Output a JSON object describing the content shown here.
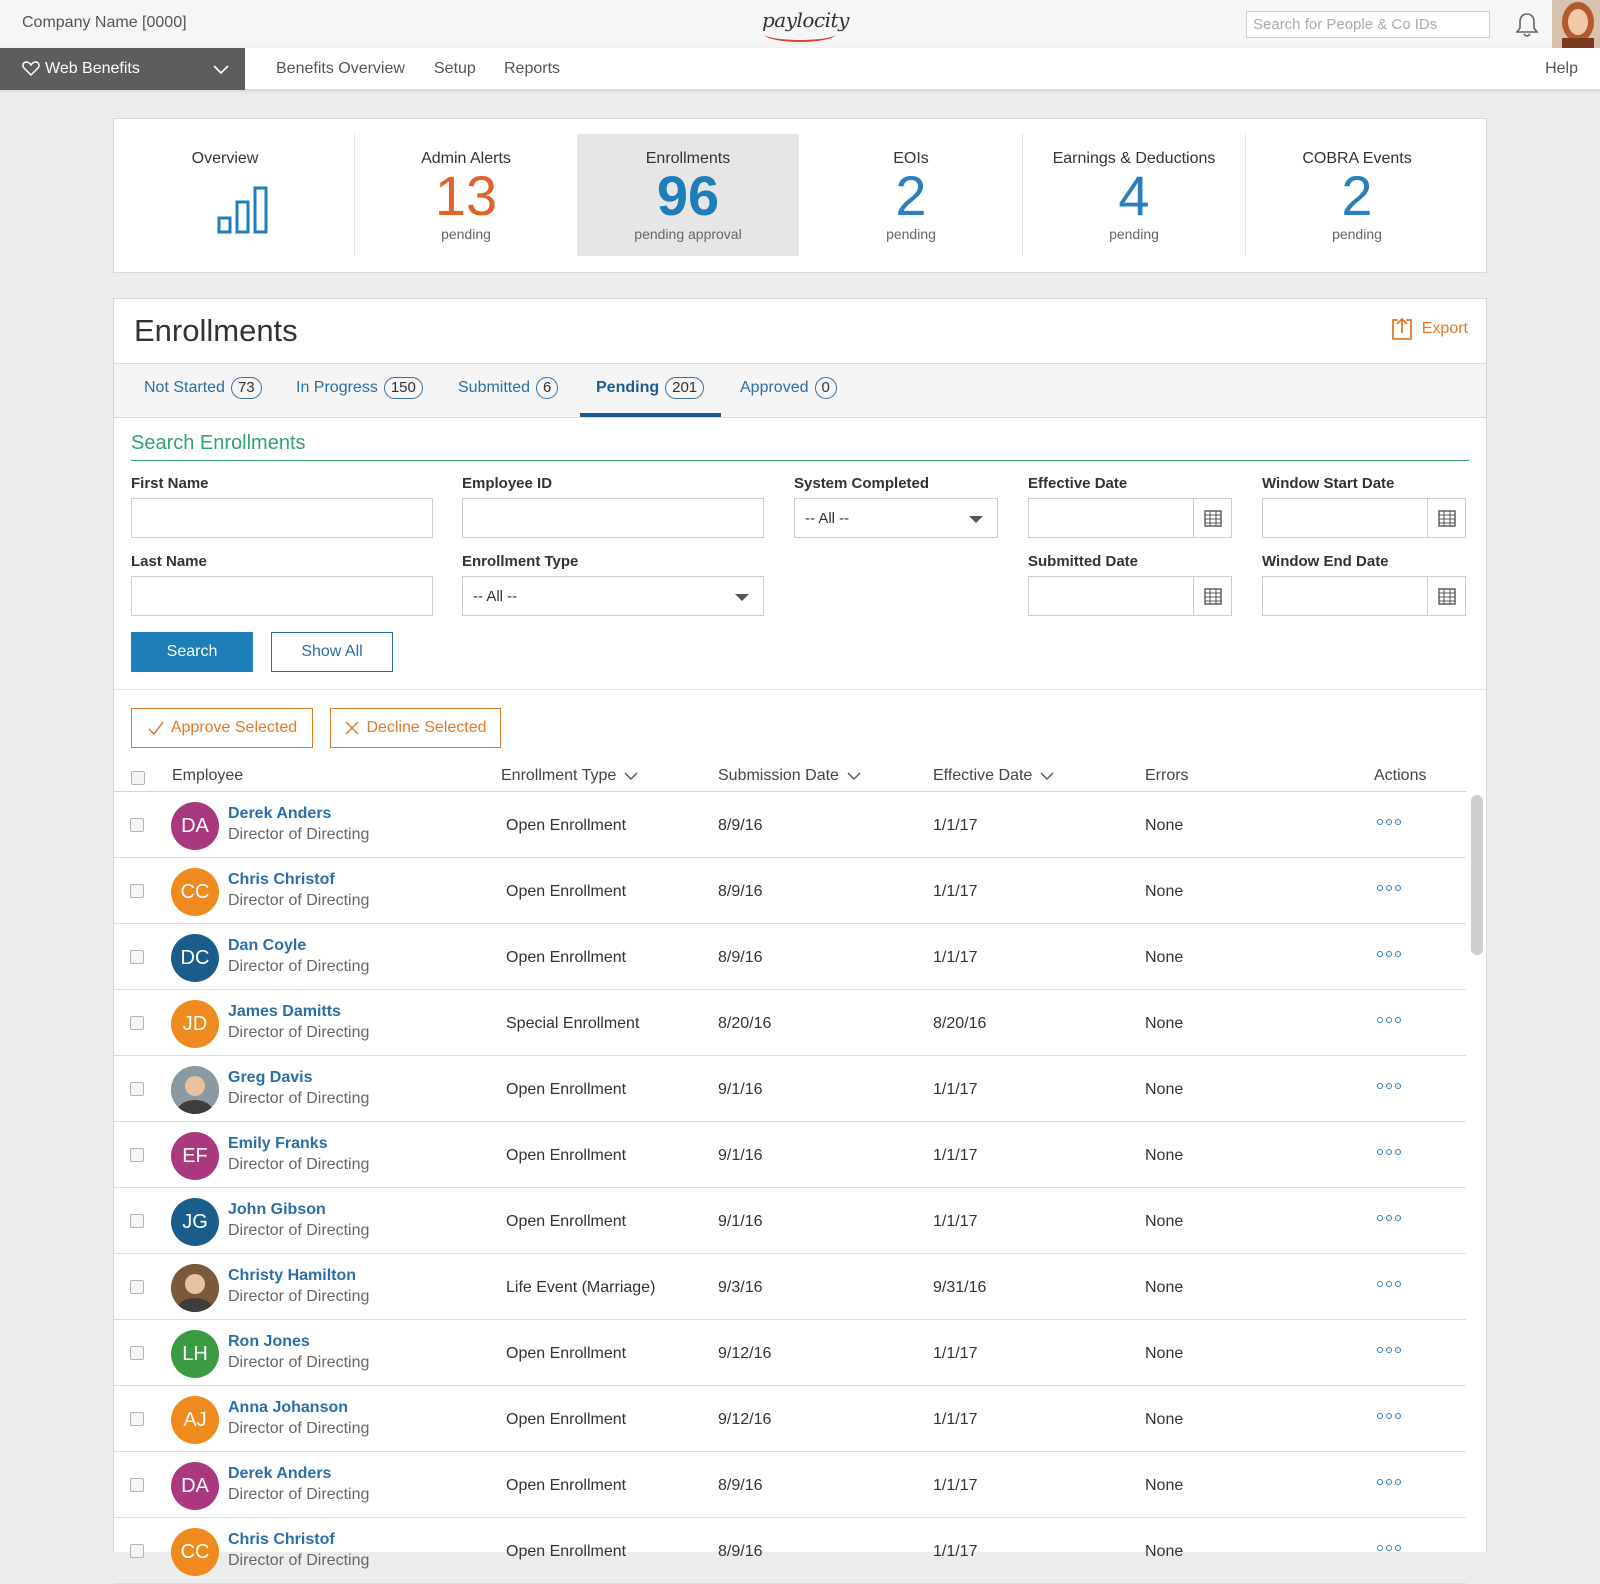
{
  "topbar": {
    "company": "Company Name [0000]",
    "logo": "paylocity",
    "search_placeholder": "Search for People & Co IDs"
  },
  "nav": {
    "product": "Web Benefits",
    "links": [
      "Benefits Overview",
      "Setup",
      "Reports"
    ],
    "help": "Help"
  },
  "stats": {
    "overview": "Overview",
    "tiles": [
      {
        "label": "Admin Alerts",
        "value": "13",
        "sub": "pending",
        "color": "#e0642a"
      },
      {
        "label": "Enrollments",
        "value": "96",
        "sub": "pending approval",
        "color": "#1e7fb8"
      },
      {
        "label": "EOIs",
        "value": "2",
        "sub": "pending",
        "color": "#2a7fc0"
      },
      {
        "label": "Earnings & Deductions",
        "value": "4",
        "sub": "pending",
        "color": "#2a7fc0"
      },
      {
        "label": "COBRA Events",
        "value": "2",
        "sub": "pending",
        "color": "#2a7fc0"
      }
    ]
  },
  "enrollments": {
    "title": "Enrollments",
    "export": "Export",
    "tabs": [
      {
        "label": "Not Started",
        "count": "73"
      },
      {
        "label": "In Progress",
        "count": "150"
      },
      {
        "label": "Submitted",
        "count": "6"
      },
      {
        "label": "Pending",
        "count": "201"
      },
      {
        "label": "Approved",
        "count": "0"
      }
    ]
  },
  "search": {
    "title": "Search Enrollments",
    "first_name": "First Name",
    "employee_id": "Employee ID",
    "system_completed": "System Completed",
    "system_completed_value": "-- All --",
    "effective_date": "Effective Date",
    "window_start": "Window Start Date",
    "last_name": "Last Name",
    "enrollment_type": "Enrollment Type",
    "enrollment_type_value": "-- All --",
    "submitted_date": "Submitted Date",
    "window_end": "Window End Date",
    "search_btn": "Search",
    "show_all_btn": "Show All"
  },
  "actions": {
    "approve": "Approve Selected",
    "decline": "Decline Selected"
  },
  "table": {
    "headers": {
      "employee": "Employee",
      "enrollment_type": "Enrollment Type",
      "submission_date": "Submission Date",
      "effective_date": "Effective Date",
      "errors": "Errors",
      "actions": "Actions"
    },
    "rows": [
      {
        "initials": "DA",
        "color": "#a9387f",
        "name": "Derek Anders",
        "title": "Director of Directing",
        "type": "Open Enrollment",
        "submitted": "8/9/16",
        "effective": "1/1/17",
        "errors": "None"
      },
      {
        "initials": "CC",
        "color": "#ee8a1e",
        "name": "Chris Christof",
        "title": "Director of Directing",
        "type": "Open Enrollment",
        "submitted": "8/9/16",
        "effective": "1/1/17",
        "errors": "None"
      },
      {
        "initials": "DC",
        "color": "#1b5d8a",
        "name": "Dan Coyle",
        "title": "Director of Directing",
        "type": "Open Enrollment",
        "submitted": "8/9/16",
        "effective": "1/1/17",
        "errors": "None"
      },
      {
        "initials": "JD",
        "color": "#ee8a1e",
        "name": "James Damitts",
        "title": "Director of Directing",
        "type": "Special Enrollment",
        "submitted": "8/20/16",
        "effective": "8/20/16",
        "errors": "None"
      },
      {
        "initials": "",
        "color": "#8a9aa0",
        "name": "Greg Davis",
        "title": "Director of Directing",
        "type": "Open Enrollment",
        "submitted": "9/1/16",
        "effective": "1/1/17",
        "errors": "None"
      },
      {
        "initials": "EF",
        "color": "#a9387f",
        "name": "Emily Franks",
        "title": "Director of Directing",
        "type": "Open Enrollment",
        "submitted": "9/1/16",
        "effective": "1/1/17",
        "errors": "None"
      },
      {
        "initials": "JG",
        "color": "#1b5d8a",
        "name": "John Gibson",
        "title": "Director of Directing",
        "type": "Open Enrollment",
        "submitted": "9/1/16",
        "effective": "1/1/17",
        "errors": "None"
      },
      {
        "initials": "",
        "color": "#7a5a3a",
        "name": "Christy Hamilton",
        "title": "Director of Directing",
        "type": "Life Event (Marriage)",
        "submitted": "9/3/16",
        "effective": "9/31/16",
        "errors": "None"
      },
      {
        "initials": "LH",
        "color": "#3c9a45",
        "name": "Ron Jones",
        "title": "Director of Directing",
        "type": "Open Enrollment",
        "submitted": "9/12/16",
        "effective": "1/1/17",
        "errors": "None"
      },
      {
        "initials": "AJ",
        "color": "#ee8a1e",
        "name": "Anna Johanson",
        "title": "Director of Directing",
        "type": "Open Enrollment",
        "submitted": "9/12/16",
        "effective": "1/1/17",
        "errors": "None"
      },
      {
        "initials": "DA",
        "color": "#a9387f",
        "name": "Derek Anders",
        "title": "Director of Directing",
        "type": "Open Enrollment",
        "submitted": "8/9/16",
        "effective": "1/1/17",
        "errors": "None"
      },
      {
        "initials": "CC",
        "color": "#ee8a1e",
        "name": "Chris Christof",
        "title": "Director of Directing",
        "type": "Open Enrollment",
        "submitted": "8/9/16",
        "effective": "1/1/17",
        "errors": "None"
      }
    ]
  }
}
